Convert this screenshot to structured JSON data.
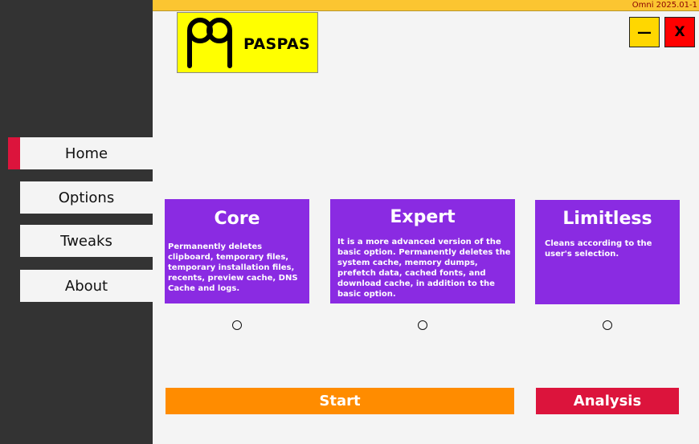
{
  "app": {
    "version": "Omni 2025.01-1",
    "logo_text": "PASPAS"
  },
  "window_controls": {
    "minimize_label": "—",
    "close_label": "X"
  },
  "sidebar": {
    "items": [
      {
        "label": "Home",
        "active": true
      },
      {
        "label": "Options",
        "active": false
      },
      {
        "label": "Tweaks",
        "active": false
      },
      {
        "label": "About",
        "active": false
      }
    ]
  },
  "modes": [
    {
      "title": "Core",
      "description": "Permanently deletes clipboard, temporary files, temporary installation files, recents, preview cache, DNS Cache and logs.",
      "selected": false
    },
    {
      "title": "Expert",
      "description": "It is a more advanced version of the basic option. Permanently deletes the system cache, memory dumps, prefetch data, cached fonts, and download cache, in addition to the basic option.",
      "selected": false
    },
    {
      "title": "Limitless",
      "description": "Cleans according to the user's selection.",
      "selected": false
    }
  ],
  "actions": {
    "start_label": "Start",
    "analysis_label": "Analysis"
  },
  "colors": {
    "sidebar": "#333333",
    "active_marker": "#dc143c",
    "topbar": "#fbc531",
    "card": "#8a2be2",
    "start": "#ff8c00",
    "analysis": "#dc143c",
    "logo_bg": "#ffff00"
  }
}
